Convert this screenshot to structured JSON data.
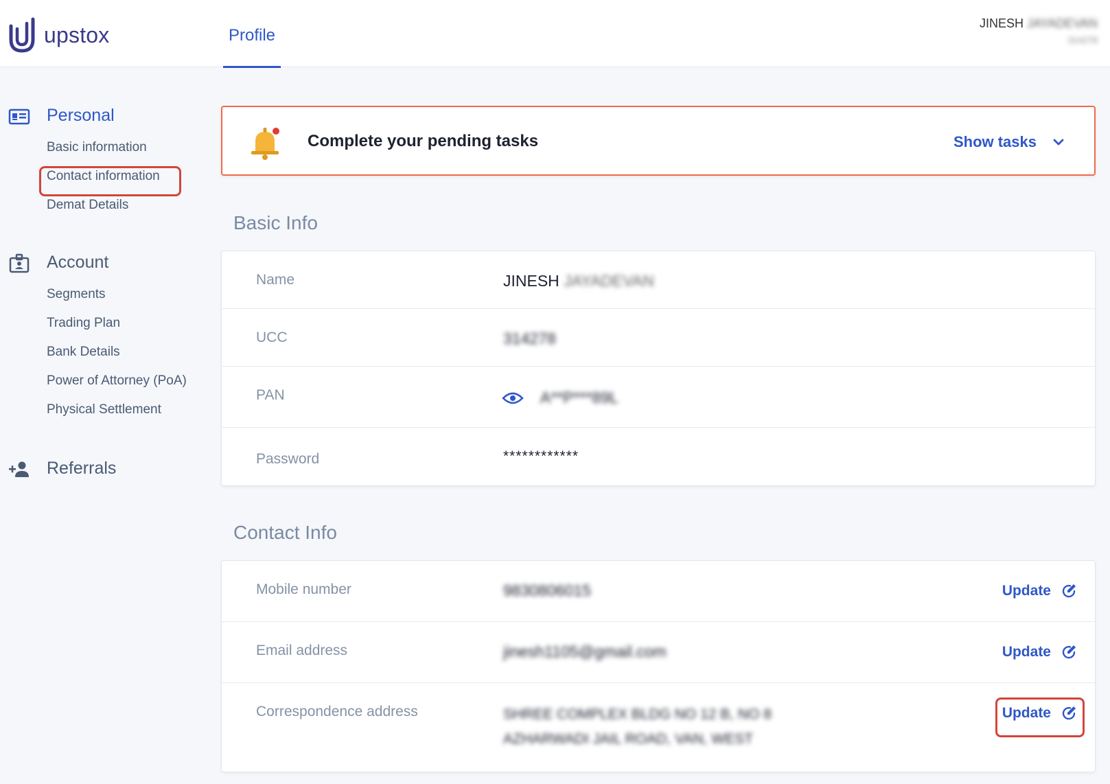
{
  "header": {
    "brand": "upstox",
    "tab": "Profile",
    "user_name": "JINESH",
    "user_name_hidden": "JAYADEVAN",
    "user_id_hidden": "314278"
  },
  "sidebar": {
    "personal": {
      "title": "Personal",
      "items": [
        "Basic information",
        "Contact information",
        "Demat Details"
      ]
    },
    "account": {
      "title": "Account",
      "items": [
        "Segments",
        "Trading Plan",
        "Bank Details",
        "Power of Attorney (PoA)",
        "Physical Settlement"
      ]
    },
    "referrals": {
      "title": "Referrals"
    }
  },
  "pending": {
    "text": "Complete your pending tasks",
    "action": "Show tasks"
  },
  "basic_info": {
    "title": "Basic Info",
    "rows": [
      {
        "label": "Name",
        "value": "JINESH",
        "hidden": "JAYADEVAN"
      },
      {
        "label": "UCC",
        "hidden": "314278"
      },
      {
        "label": "PAN",
        "hidden": "A**P***89L"
      },
      {
        "label": "Password",
        "value": "************"
      }
    ]
  },
  "contact_info": {
    "title": "Contact Info",
    "rows": [
      {
        "label": "Mobile number",
        "hidden": "9830806015",
        "action": "Update"
      },
      {
        "label": "Email address",
        "hidden": "jinesh1105@gmail.com",
        "action": "Update"
      },
      {
        "label": "Correspondence address",
        "hidden_line1": "SHREE COMPLEX BLDG NO 12 B, NO 8",
        "hidden_line2": "AZHARWADI JAIL ROAD, VAN, WEST",
        "action": "Update"
      }
    ]
  },
  "colors": {
    "accent": "#2f57c8",
    "highlight": "#d2453a",
    "pending_border": "#ef6a4a",
    "bell": "#f5b43a"
  }
}
